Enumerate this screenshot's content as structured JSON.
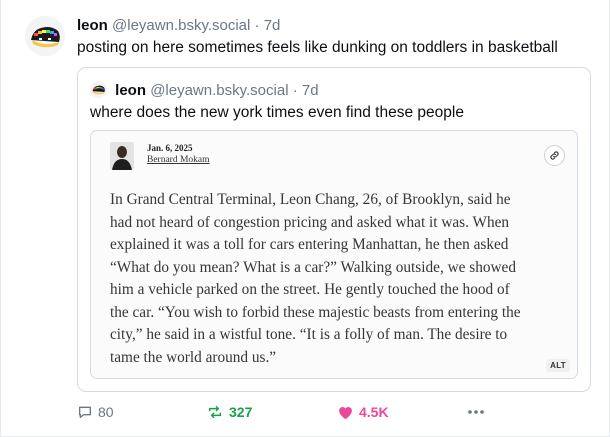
{
  "post": {
    "author_name": "leon",
    "handle": "@leyawn.bsky.social",
    "separator": "·",
    "time": "7d",
    "text": "posting on here sometimes feels like dunking on toddlers in basketball"
  },
  "quote": {
    "author_name": "leon",
    "handle": "@leyawn.bsky.social",
    "separator": "·",
    "time": "7d",
    "text": "where does the new york times even find these people",
    "image": {
      "date": "Jan. 6, 2025",
      "author": "Bernard Mokam",
      "article_lines": [
        "In Grand Central Terminal, Leon Chang, 26, of Brooklyn, said he",
        "had not heard of congestion pricing and asked what it was. When",
        "explained it was a toll for cars entering Manhattan, he then asked",
        "“What do you mean? What is a car?” Walking outside, we showed",
        "him a vehicle parked on the street. He gently touched the hood of",
        "the car. “You wish to forbid these majestic beasts from entering the",
        "city,” he said in a wistful tone. “It is a folly of man. The desire to",
        "tame the world around us.”"
      ],
      "alt_badge": "ALT",
      "link_icon": "link-icon"
    }
  },
  "actions": {
    "reply_count": "80",
    "repost_count": "327",
    "like_count": "4.5K",
    "reply_icon": "reply-icon",
    "repost_icon": "repost-icon",
    "like_icon": "heart-icon",
    "more_icon": "more-icon"
  },
  "colors": {
    "repost": "#14a34a",
    "like": "#ec4899",
    "muted": "#6b7785",
    "border": "#d4dbe2"
  }
}
